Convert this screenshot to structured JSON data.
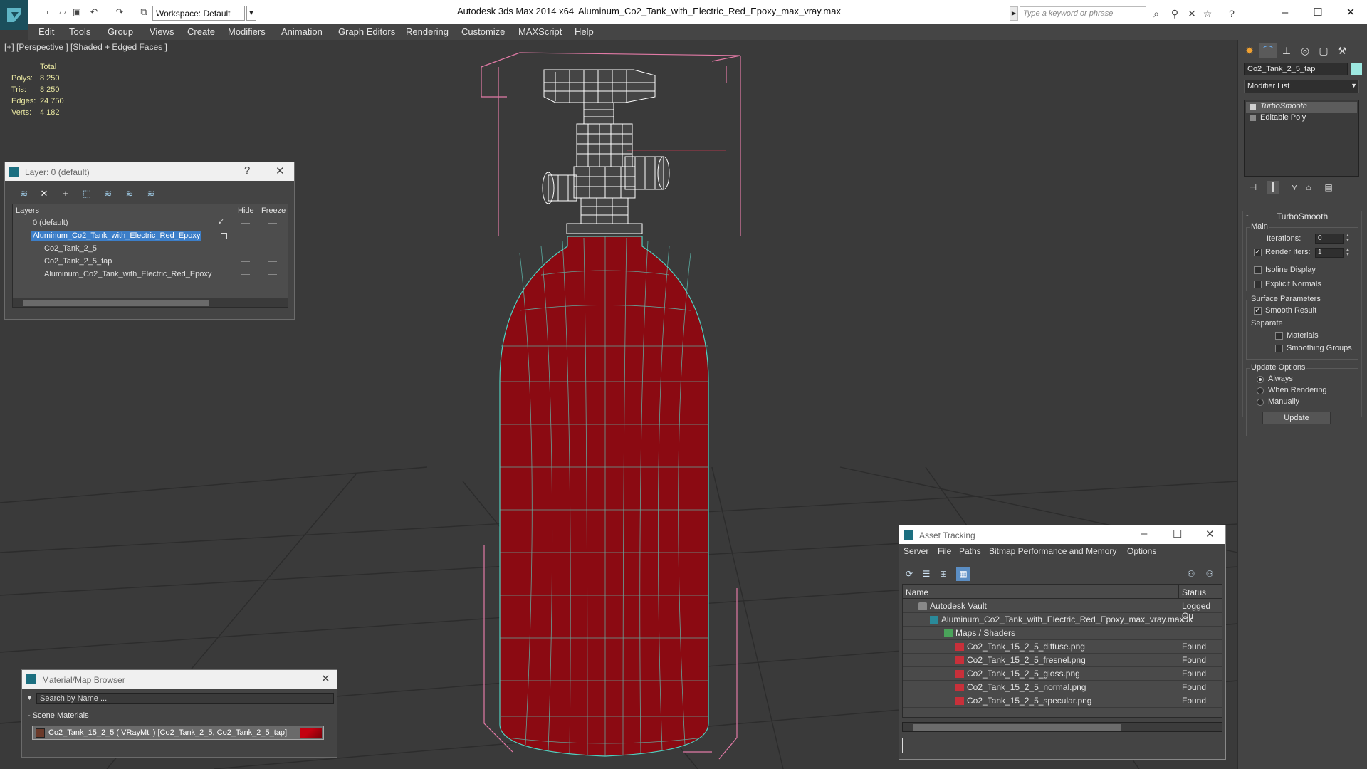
{
  "titlebar": {
    "app_title": "Autodesk 3ds Max  2014 x64",
    "doc_title": "Aluminum_Co2_Tank_with_Electric_Red_Epoxy_max_vray.max",
    "workspace": "Workspace: Default",
    "search_placeholder": "Type a keyword or phrase",
    "window_controls": {
      "minimize": "–",
      "maximize": "☐",
      "close": "✕"
    }
  },
  "menu": [
    "Edit",
    "Tools",
    "Group",
    "Views",
    "Create",
    "Modifiers",
    "Animation",
    "Graph Editors",
    "Rendering",
    "Customize",
    "MAXScript",
    "Help"
  ],
  "viewport": {
    "label": "[+] [Perspective ] [Shaded + Edged Faces ]",
    "stats": {
      "header": "Total",
      "rows": [
        {
          "label": "Polys:",
          "value": "8 250"
        },
        {
          "label": "Tris:",
          "value": "8 250"
        },
        {
          "label": "Edges:",
          "value": "24 750"
        },
        {
          "label": "Verts:",
          "value": "4 182"
        }
      ]
    },
    "colors": {
      "tank_body": "#8b0a12",
      "wire": "#4fd0c0",
      "bbox": "#e27aa6",
      "grid": "#2a2a2a"
    }
  },
  "layer_dialog": {
    "title": "Layer: 0 (default)",
    "help": "?",
    "close": "✕",
    "columns": {
      "layers": "Layers",
      "hide": "Hide",
      "freeze": "Freeze"
    },
    "rows": [
      {
        "name": "0 (default)",
        "indent": 1,
        "current": true,
        "selected": false
      },
      {
        "name": "Aluminum_Co2_Tank_with_Electric_Red_Epoxy",
        "indent": 1,
        "current": false,
        "selected": true
      },
      {
        "name": "Co2_Tank_2_5",
        "indent": 2,
        "current": false,
        "selected": false
      },
      {
        "name": "Co2_Tank_2_5_tap",
        "indent": 2,
        "current": false,
        "selected": false
      },
      {
        "name": "Aluminum_Co2_Tank_with_Electric_Red_Epoxy",
        "indent": 2,
        "current": false,
        "selected": false
      }
    ]
  },
  "material_browser": {
    "title": "Material/Map Browser",
    "close": "✕",
    "search_placeholder": "Search by Name ...",
    "group": "- Scene Materials",
    "item": "Co2_Tank_15_2_5  ( VRayMtl ) [Co2_Tank_2_5, Co2_Tank_2_5_tap]"
  },
  "asset_tracking": {
    "title": "Asset Tracking",
    "menu": [
      "Server",
      "File",
      "Paths",
      "Bitmap Performance and Memory",
      "Options"
    ],
    "columns": {
      "name": "Name",
      "status": "Status"
    },
    "rows": [
      {
        "name": "Autodesk Vault",
        "status": "Logged Ou",
        "indent": 1,
        "icon": "vault-icon"
      },
      {
        "name": "Aluminum_Co2_Tank_with_Electric_Red_Epoxy_max_vray.max",
        "status": "Ok",
        "indent": 2,
        "icon": "max-file-icon"
      },
      {
        "name": "Maps / Shaders",
        "status": "",
        "indent": 3,
        "icon": "maps-icon"
      },
      {
        "name": "Co2_Tank_15_2_5_diffuse.png",
        "status": "Found",
        "indent": 4,
        "icon": "png-icon"
      },
      {
        "name": "Co2_Tank_15_2_5_fresnel.png",
        "status": "Found",
        "indent": 4,
        "icon": "png-icon"
      },
      {
        "name": "Co2_Tank_15_2_5_gloss.png",
        "status": "Found",
        "indent": 4,
        "icon": "png-icon"
      },
      {
        "name": "Co2_Tank_15_2_5_normal.png",
        "status": "Found",
        "indent": 4,
        "icon": "png-icon"
      },
      {
        "name": "Co2_Tank_15_2_5_specular.png",
        "status": "Found",
        "indent": 4,
        "icon": "png-icon"
      }
    ]
  },
  "command_panel": {
    "object_name": "Co2_Tank_2_5_tap",
    "object_color": "#9de8e0",
    "modifier_list": "Modifier List",
    "stack": [
      {
        "name": "TurboSmooth",
        "active": true
      },
      {
        "name": "Editable Poly",
        "active": false
      }
    ],
    "turbosmooth": {
      "title": "TurboSmooth",
      "main_label": "Main",
      "iterations_label": "Iterations:",
      "iterations_value": "0",
      "render_iters_label": "Render Iters:",
      "render_iters_value": "1",
      "render_iters_checked": true,
      "isoline_label": "Isoline Display",
      "isoline_checked": false,
      "explicit_label": "Explicit Normals",
      "explicit_checked": false,
      "surface_label": "Surface Parameters",
      "smooth_result_label": "Smooth Result",
      "smooth_result_checked": true,
      "separate_label": "Separate",
      "materials_label": "Materials",
      "smoothing_groups_label": "Smoothing Groups",
      "update_options_label": "Update Options",
      "always_label": "Always",
      "when_rendering_label": "When Rendering",
      "manually_label": "Manually",
      "update_mode": "Always",
      "update_button": "Update"
    }
  }
}
